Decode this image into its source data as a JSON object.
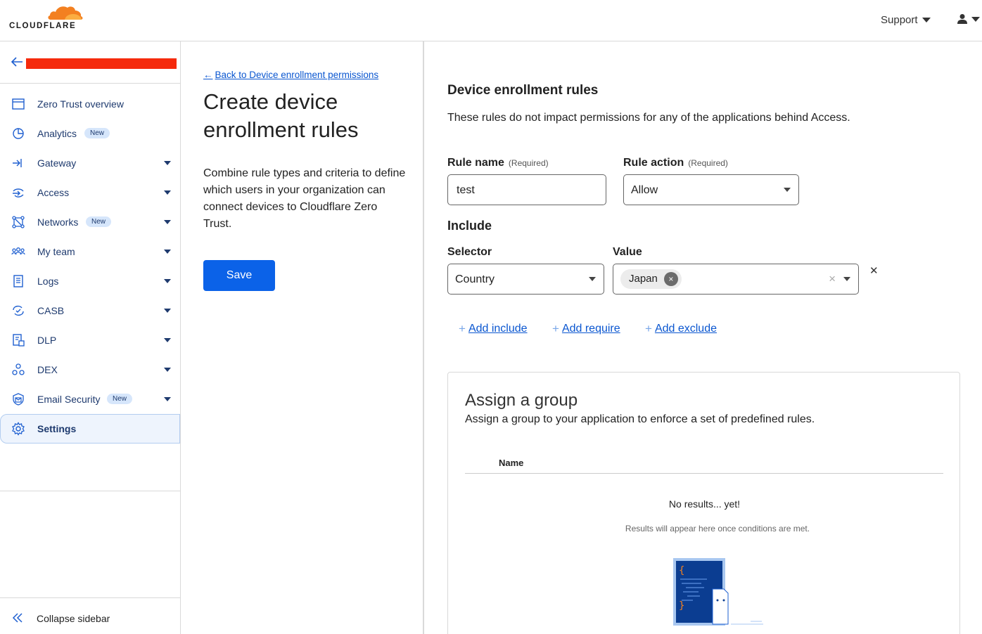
{
  "header": {
    "logo_text": "CLOUDFLARE",
    "support_label": "Support",
    "user_icon": "user-icon"
  },
  "sidebar": {
    "back_icon": "arrow-left-icon",
    "items": [
      {
        "label": "Zero Trust overview",
        "icon": "browser-window-icon",
        "badge": "",
        "dropdown": false,
        "active": false
      },
      {
        "label": "Analytics",
        "icon": "analytics-icon",
        "badge": "New",
        "dropdown": false,
        "active": false
      },
      {
        "label": "Gateway",
        "icon": "gateway-icon",
        "badge": "",
        "dropdown": true,
        "active": false
      },
      {
        "label": "Access",
        "icon": "access-icon",
        "badge": "",
        "dropdown": true,
        "active": false
      },
      {
        "label": "Networks",
        "icon": "networks-icon",
        "badge": "New",
        "dropdown": true,
        "active": false
      },
      {
        "label": "My team",
        "icon": "team-icon",
        "badge": "",
        "dropdown": true,
        "active": false
      },
      {
        "label": "Logs",
        "icon": "logs-icon",
        "badge": "",
        "dropdown": true,
        "active": false
      },
      {
        "label": "CASB",
        "icon": "casb-icon",
        "badge": "",
        "dropdown": true,
        "active": false
      },
      {
        "label": "DLP",
        "icon": "dlp-icon",
        "badge": "",
        "dropdown": true,
        "active": false
      },
      {
        "label": "DEX",
        "icon": "dex-icon",
        "badge": "",
        "dropdown": true,
        "active": false
      },
      {
        "label": "Email Security",
        "icon": "email-security-icon",
        "badge": "New",
        "dropdown": true,
        "active": false
      },
      {
        "label": "Settings",
        "icon": "gear-icon",
        "badge": "",
        "dropdown": false,
        "active": true
      }
    ],
    "collapse_label": "Collapse sidebar"
  },
  "middle": {
    "back_link": "Back to Device enrollment permissions",
    "title": "Create device enrollment rules",
    "description": "Combine rule types and criteria to define which users in your organization can connect devices to Cloudflare Zero Trust.",
    "save_label": "Save"
  },
  "form": {
    "section_title": "Device enrollment rules",
    "section_desc": "These rules do not impact permissions for any of the applications behind Access.",
    "rule_name_label": "Rule name",
    "rule_name_req": "(Required)",
    "rule_name_value": "test",
    "rule_action_label": "Rule action",
    "rule_action_req": "(Required)",
    "rule_action_value": "Allow",
    "include_label": "Include",
    "selector_label": "Selector",
    "selector_value": "Country",
    "value_label": "Value",
    "value_chip": "Japan",
    "add_include": "Add include",
    "add_require": "Add require",
    "add_exclude": "Add exclude"
  },
  "group": {
    "title": "Assign a group",
    "description": "Assign a group to your application to enforce a set of predefined rules.",
    "column_name": "Name",
    "empty_title": "No results... yet!",
    "empty_sub": "Results will appear here once conditions are met."
  },
  "colors": {
    "accent": "#0b62e8",
    "link": "#0a56d0",
    "logo_orange": "#f38020",
    "redaction": "#f52a0c"
  }
}
